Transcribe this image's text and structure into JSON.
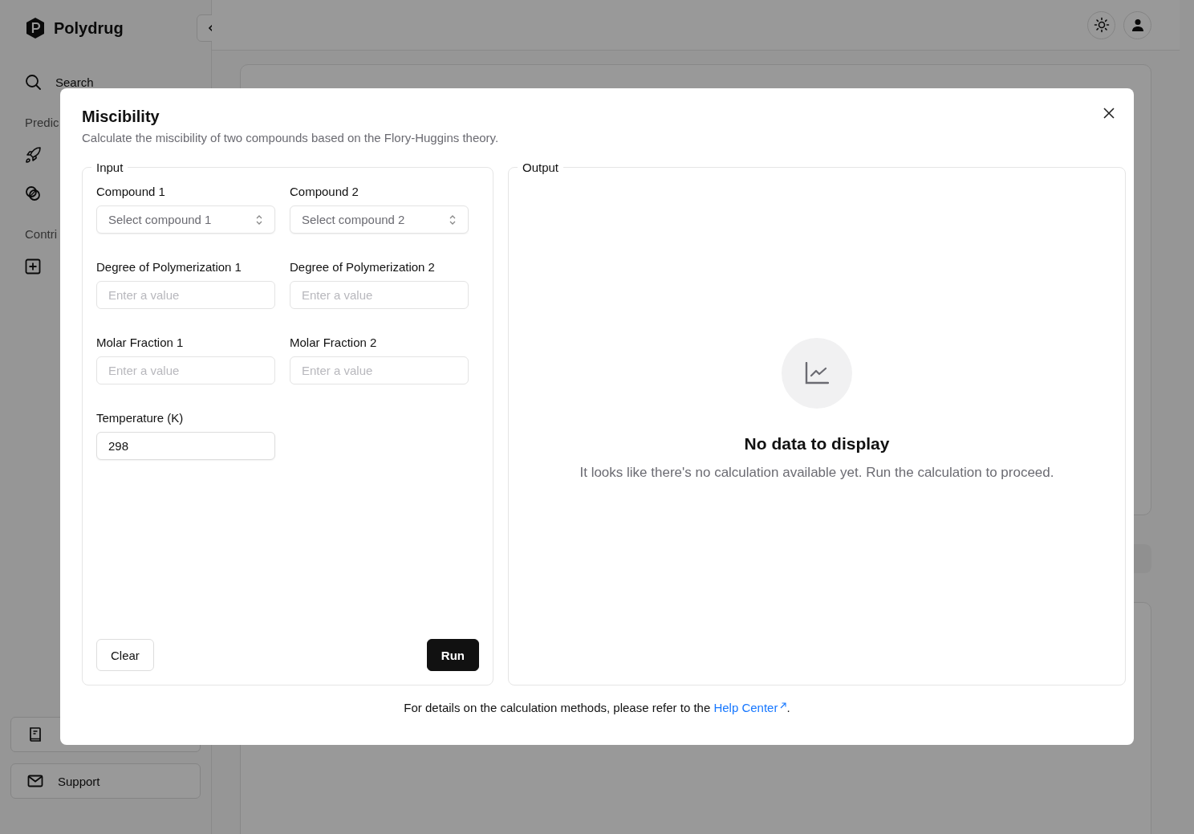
{
  "app": {
    "name": "Polydrug"
  },
  "sidebar": {
    "search": "Search",
    "sections": [
      {
        "title": "Predic",
        "items": [
          {
            "kind": "rocket"
          },
          {
            "kind": "circles"
          }
        ]
      },
      {
        "title": "Contri",
        "items": [
          {
            "kind": "plus"
          }
        ]
      }
    ],
    "bottom": [
      {
        "kind": "book"
      },
      {
        "kind": "mail",
        "label": "Support"
      }
    ]
  },
  "modal": {
    "title": "Miscibility",
    "description": "Calculate the miscibility of two compounds based on the Flory-Huggins theory.",
    "input": {
      "legend": "Input",
      "fields": [
        {
          "kind": "select",
          "label": "Compound 1",
          "placeholder": "Select compound 1"
        },
        {
          "kind": "select",
          "label": "Compound 2",
          "placeholder": "Select compound 2"
        },
        {
          "kind": "input",
          "label": "Degree of Polymerization 1",
          "placeholder": "Enter a value"
        },
        {
          "kind": "input",
          "label": "Degree of Polymerization 2",
          "placeholder": "Enter a value"
        },
        {
          "kind": "input",
          "label": "Molar Fraction 1",
          "placeholder": "Enter a value"
        },
        {
          "kind": "input",
          "label": "Molar Fraction 2",
          "placeholder": "Enter a value"
        },
        {
          "kind": "input",
          "label": "Temperature (K)",
          "value": "298"
        }
      ],
      "buttons": [
        {
          "kind": "secondary",
          "label": "Clear"
        },
        {
          "kind": "primary",
          "label": "Run"
        }
      ]
    },
    "output": {
      "legend": "Output",
      "empty_title": "No data to display",
      "empty_text": "It looks like there's no calculation available yet. Run the calculation to proceed."
    },
    "footer": {
      "text": "For details on the calculation methods, please refer to the ",
      "link": "Help Center",
      "after": "."
    }
  }
}
